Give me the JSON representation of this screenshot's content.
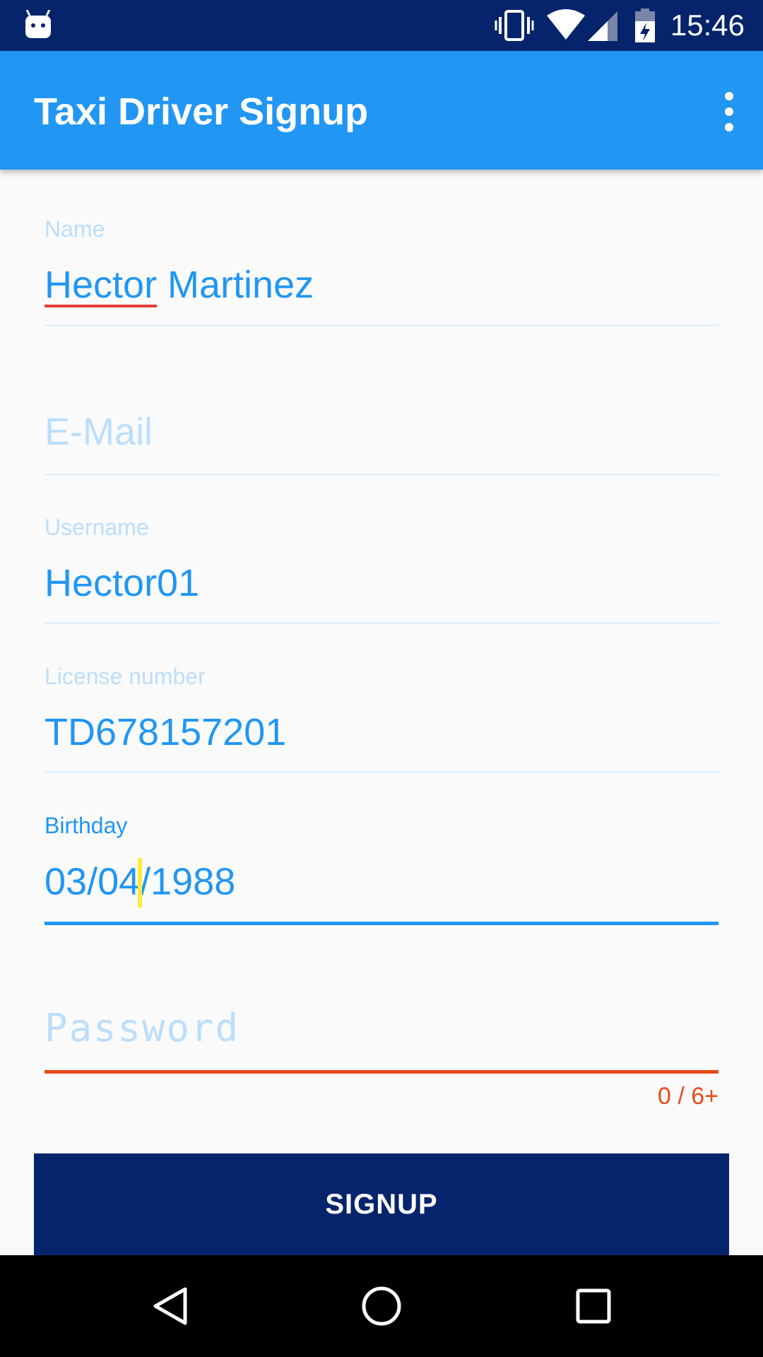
{
  "status_bar": {
    "time": "15:46",
    "icons": [
      "android-robot-icon",
      "vibrate-icon",
      "wifi-icon",
      "cell-signal-icon",
      "battery-charging-icon"
    ]
  },
  "app_bar": {
    "title": "Taxi Driver Signup",
    "overflow_icon": "more-vert-icon",
    "color": "#2196f3"
  },
  "form": {
    "name": {
      "label": "Name",
      "value_first": "Hector",
      "value_rest": " Martinez"
    },
    "email": {
      "placeholder": "E-Mail"
    },
    "username": {
      "label": "Username",
      "value": "Hector01"
    },
    "license": {
      "label": "License number",
      "value": "TD678157201"
    },
    "birthday": {
      "label": "Birthday",
      "value_before_cursor": "03/04",
      "value_after_cursor": "/1988"
    },
    "password": {
      "placeholder": "Password",
      "counter": "0 / 6+"
    }
  },
  "signup_button": {
    "label": "SIGNUP",
    "color": "#05246c"
  },
  "nav_bar": {
    "icons": [
      "back-icon",
      "home-icon",
      "recents-icon"
    ]
  }
}
